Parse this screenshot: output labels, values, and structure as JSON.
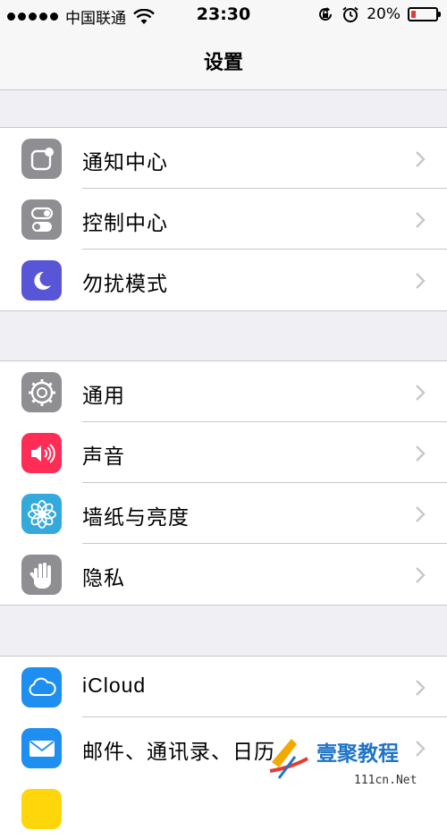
{
  "status_bar": {
    "carrier": "中国联通",
    "time": "23:30",
    "battery_percent": "20%",
    "battery_level": 0.2,
    "battery_color": "#e53935"
  },
  "nav": {
    "title": "设置"
  },
  "groups": [
    {
      "items": [
        {
          "label": "通知中心",
          "icon": "notification-center-icon",
          "color": "#8e8e93"
        },
        {
          "label": "控制中心",
          "icon": "control-center-icon",
          "color": "#8e8e93"
        },
        {
          "label": "勿扰模式",
          "icon": "moon-icon",
          "color": "#5856d6"
        }
      ]
    },
    {
      "items": [
        {
          "label": "通用",
          "icon": "gear-icon",
          "color": "#8e8e93"
        },
        {
          "label": "声音",
          "icon": "speaker-icon",
          "color": "#ff2d55"
        },
        {
          "label": "墙纸与亮度",
          "icon": "flower-icon",
          "color": "#34aadc"
        },
        {
          "label": "隐私",
          "icon": "hand-icon",
          "color": "#8e8e93"
        }
      ]
    },
    {
      "items": [
        {
          "label": "iCloud",
          "icon": "cloud-icon",
          "color": "#1e8ef0"
        },
        {
          "label": "邮件、通讯录、日历",
          "icon": "mail-icon",
          "color": "#1e8ef0"
        }
      ]
    }
  ],
  "watermark": {
    "text": "壹聚教程",
    "url": "111cn.Net"
  }
}
